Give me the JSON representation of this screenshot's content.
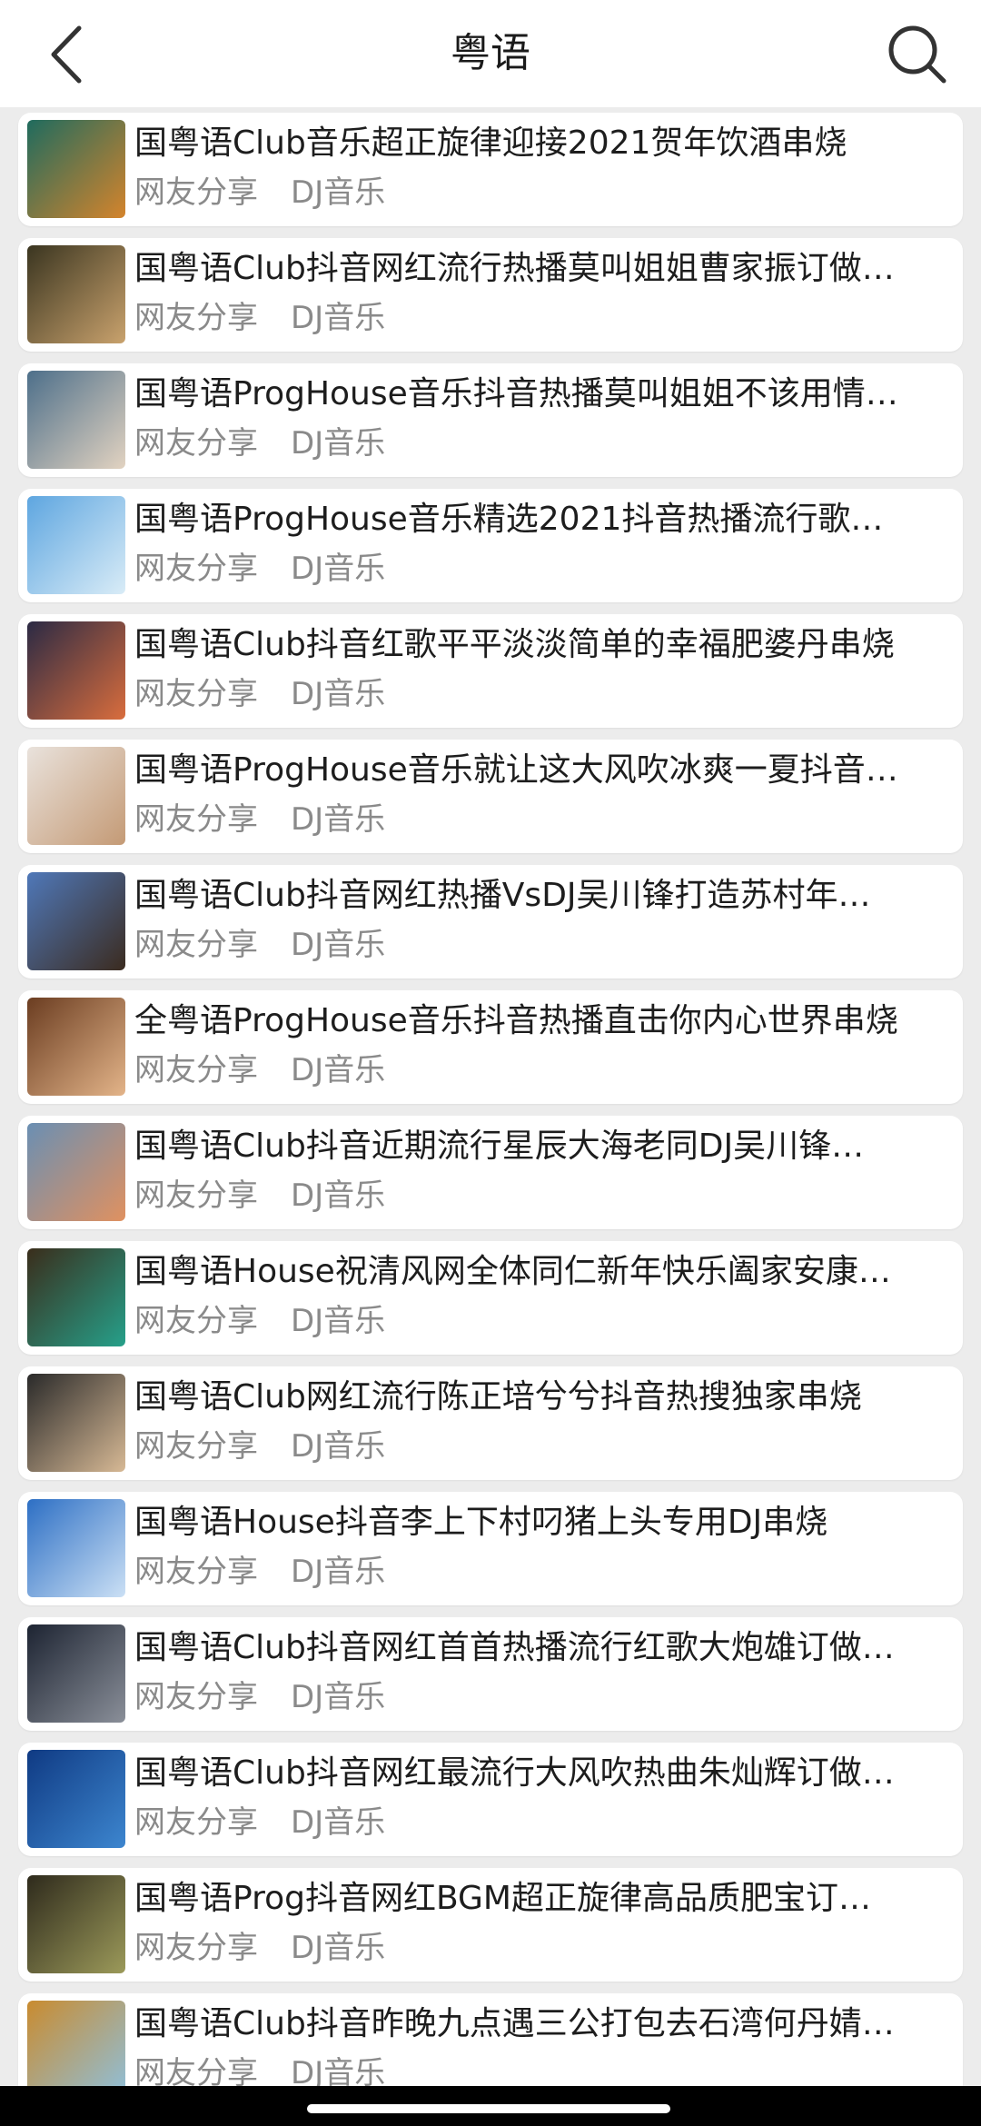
{
  "header": {
    "title": "粤语",
    "back_icon": "chevron-left-icon",
    "search_icon": "search-icon"
  },
  "items": [
    {
      "title": "国粤语Club音乐超正旋律迎接2021贺年饮酒串烧",
      "source": "网友分享",
      "category": "DJ音乐",
      "thumb": [
        "#1f6b5e",
        "#d4842c"
      ]
    },
    {
      "title": "国粤语Club抖音网红流行热播莫叫姐姐曹家振订做…",
      "source": "网友分享",
      "category": "DJ音乐",
      "thumb": [
        "#3a3520",
        "#c9a26d"
      ]
    },
    {
      "title": "国粤语ProgHouse音乐抖音热播莫叫姐姐不该用情…",
      "source": "网友分享",
      "category": "DJ音乐",
      "thumb": [
        "#4d6f8a",
        "#e2d3c1"
      ]
    },
    {
      "title": "国粤语ProgHouse音乐精选2021抖音热播流行歌…",
      "source": "网友分享",
      "category": "DJ音乐",
      "thumb": [
        "#5ea6e0",
        "#d9ecf7"
      ]
    },
    {
      "title": "国粤语Club抖音红歌平平淡淡简单的幸福肥婆丹串烧",
      "source": "网友分享",
      "category": "DJ音乐",
      "thumb": [
        "#2b2a44",
        "#d96d3d"
      ]
    },
    {
      "title": "国粤语ProgHouse音乐就让这大风吹冰爽一夏抖音…",
      "source": "网友分享",
      "category": "DJ音乐",
      "thumb": [
        "#e9e2dc",
        "#c49a75"
      ]
    },
    {
      "title": "国粤语Club抖音网红热播VsDJ吴川锋打造苏村年…",
      "source": "网友分享",
      "category": "DJ音乐",
      "thumb": [
        "#4f78b9",
        "#3b2b1f"
      ]
    },
    {
      "title": "全粤语ProgHouse音乐抖音热播直击你内心世界串烧",
      "source": "网友分享",
      "category": "DJ音乐",
      "thumb": [
        "#6b3d21",
        "#e3b489"
      ]
    },
    {
      "title": "国粤语Club抖音近期流行星辰大海老同DJ吴川锋…",
      "source": "网友分享",
      "category": "DJ音乐",
      "thumb": [
        "#6a8fb3",
        "#e09160"
      ]
    },
    {
      "title": "国粤语House祝清风网全体同仁新年快乐阖家安康…",
      "source": "网友分享",
      "category": "DJ音乐",
      "thumb": [
        "#3a2d1b",
        "#26a08a"
      ]
    },
    {
      "title": "国粤语Club网红流行陈正培兮兮抖音热搜独家串烧",
      "source": "网友分享",
      "category": "DJ音乐",
      "thumb": [
        "#2a2a2a",
        "#d7b995"
      ]
    },
    {
      "title": "国粤语House抖音李上下村叼猪上头专用DJ串烧",
      "source": "网友分享",
      "category": "DJ音乐",
      "thumb": [
        "#2d6fc4",
        "#cbe0f5"
      ]
    },
    {
      "title": "国粤语Club抖音网红首首热播流行红歌大炮雄订做…",
      "source": "网友分享",
      "category": "DJ音乐",
      "thumb": [
        "#1d2432",
        "#8a8f99"
      ]
    },
    {
      "title": "国粤语Club抖音网红最流行大风吹热曲朱灿辉订做…",
      "source": "网友分享",
      "category": "DJ音乐",
      "thumb": [
        "#0f3a83",
        "#3d86cf"
      ]
    },
    {
      "title": "国粤语Prog抖音网红BGM超正旋律高品质肥宝订…",
      "source": "网友分享",
      "category": "DJ音乐",
      "thumb": [
        "#2e2a1c",
        "#9c9a5a"
      ]
    },
    {
      "title": "国粤语Club抖音昨晚九点遇三公打包去石湾何丹婧…",
      "source": "网友分享",
      "category": "DJ音乐",
      "thumb": [
        "#c98b2f",
        "#8fc0dc"
      ]
    }
  ]
}
